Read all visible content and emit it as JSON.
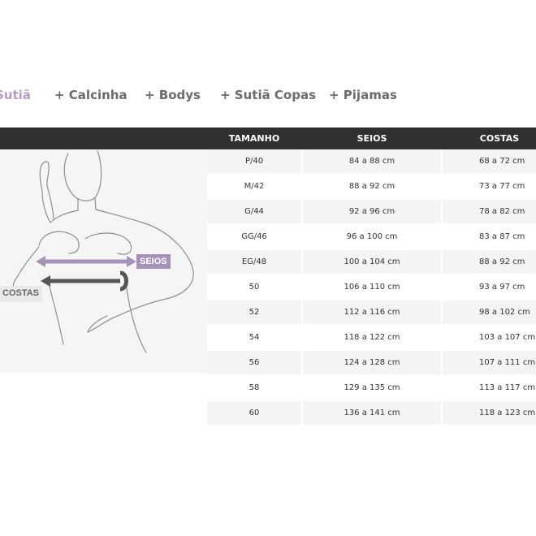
{
  "tabs": [
    {
      "label": "Sutiã",
      "active": true
    },
    {
      "label": "+ Calcinha",
      "active": false
    },
    {
      "label": "+ Bodys",
      "active": false
    },
    {
      "label": "+ Sutiã Copas",
      "active": false
    },
    {
      "label": "+ Pijamas",
      "active": false
    }
  ],
  "table": {
    "headers": [
      "TAMANHO",
      "SEIOS",
      "COSTAS"
    ],
    "rows": [
      [
        "P/40",
        "84 a 88 cm",
        "68 a 72 cm"
      ],
      [
        "M/42",
        "88 a 92 cm",
        "73 a 77 cm"
      ],
      [
        "G/44",
        "92 a 96 cm",
        "78 a 82 cm"
      ],
      [
        "GG/46",
        "96 a 100 cm",
        "83 a 87 cm"
      ],
      [
        "EG/48",
        "100 a 104 cm",
        "88 a 92 cm"
      ],
      [
        "50",
        "106 a 110 cm",
        "93 a 97 cm"
      ],
      [
        "52",
        "112 a 116 cm",
        "98 a 102 cm"
      ],
      [
        "54",
        "118 a 122 cm",
        "103 a 107 cm"
      ],
      [
        "56",
        "124 a 128 cm",
        "107 a 111 cm"
      ],
      [
        "58",
        "129 a 135 cm",
        "113 a 117 cm"
      ],
      [
        "60",
        "136 a 141 cm",
        "118 a 123 cm"
      ]
    ]
  },
  "illustration": {
    "seios_label": "SEIOS",
    "costas_label": "COSTAS",
    "colors": {
      "seios": "#a692b8",
      "costas": "#555555",
      "outline": "#8e8e8e"
    }
  }
}
